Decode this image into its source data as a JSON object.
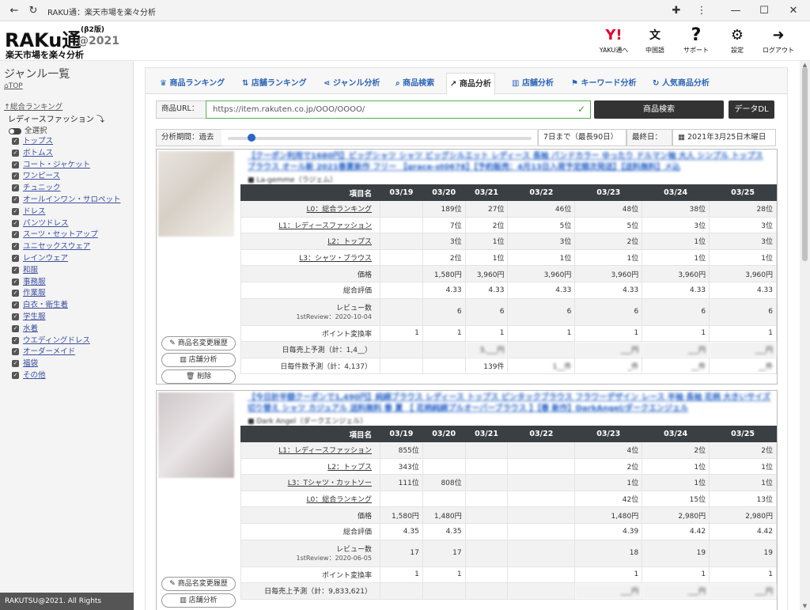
{
  "window": {
    "title": "RAKU通：楽天市場を楽々分析"
  },
  "header": {
    "logo_main": "RAKu通",
    "logo_beta": "(β2版)",
    "logo_year": "@2021",
    "logo_sub": "楽天市場を楽々分析",
    "nav": [
      {
        "icon": "Y!",
        "label": "YAKU通へ"
      },
      {
        "icon": "文",
        "label": "中国語"
      },
      {
        "icon": "?",
        "label": "サポート"
      },
      {
        "icon": "⚙",
        "label": "設定"
      },
      {
        "icon": "➜",
        "label": "ログアウト"
      }
    ]
  },
  "sidebar": {
    "title": "ジャンル一覧",
    "top_link": "TOP",
    "ranking_link": "総合ランキング",
    "category": "レディースファッション",
    "select_all": "全選択",
    "genres": [
      "トップス",
      "ボトムス",
      "コート・ジャケット",
      "ワンピース",
      "チュニック",
      "オールインワン・サロペット",
      "ドレス",
      "パンツドレス",
      "スーツ・セットアップ",
      "ユニセックスウェア",
      "レインウェア",
      "和服",
      "事務服",
      "作業服",
      "白衣・衛生着",
      "学生服",
      "水着",
      "ウエディングドレス",
      "オーダーメイド",
      "福袋",
      "その他"
    ],
    "footer": "RAKUTSU@2021. All Rights Reserved."
  },
  "tabs": [
    "商品ランキング",
    "店舗ランキング",
    "ジャンル分析",
    "商品検索",
    "商品分析",
    "店舗分析",
    "キーワード分析",
    "人気商品分析"
  ],
  "active_tab": "商品分析",
  "search": {
    "url_label": "商品URL：",
    "url_value": "https://item.rakuten.co.jp/OOO/OOOO/",
    "search_button": "商品検索",
    "download_button": "データDL"
  },
  "period": {
    "label": "分析期間：過去",
    "range_text": "7日まで（最長90日）",
    "last_date_label": "最終日：",
    "last_date_value": "2021年3月25日木曜日",
    "slider_value_days": 7,
    "slider_max_days": 90
  },
  "products": [
    {
      "title": "【クーポン利用で1680円】ビッグシャツ シャツ ビッグシルエット レディース 長袖 バンドカラー ゆったり ドルマン袖 大人 シンプル トップス ブラウス オール新 2021春夏新作 フリー 【grace-st0678】【予約販売：4月13日入荷予定順次発送】【送料無料】メ込",
      "shop": "La-gemme（ラジェム）",
      "headers": [
        "項目名",
        "03/19",
        "03/20",
        "03/21",
        "03/22",
        "03/23",
        "03/24",
        "03/25"
      ],
      "rows": [
        {
          "label": "L0：総合ランキング",
          "link": true,
          "values": [
            "",
            "189位",
            "27位",
            "46位",
            "48位",
            "38位",
            "28位"
          ]
        },
        {
          "label": "L1：レディースファッション",
          "link": true,
          "values": [
            "",
            "7位",
            "2位",
            "5位",
            "5位",
            "3位",
            "3位"
          ]
        },
        {
          "label": "L2：トップス",
          "link": true,
          "values": [
            "",
            "3位",
            "1位",
            "3位",
            "2位",
            "1位",
            "3位"
          ]
        },
        {
          "label": "L3：シャツ・ブラウス",
          "link": true,
          "values": [
            "",
            "2位",
            "1位",
            "1位",
            "1位",
            "1位",
            "1位"
          ]
        },
        {
          "label": "価格",
          "link": false,
          "values": [
            "",
            "1,580円",
            "3,960円",
            "3,960円",
            "3,960円",
            "3,960円",
            "3,960円"
          ]
        },
        {
          "label": "総合評価",
          "link": false,
          "values": [
            "",
            "4.33",
            "4.33",
            "4.33",
            "4.33",
            "4.33",
            "4.33"
          ]
        },
        {
          "label": "レビュー数",
          "sub": "1stReview：2020-10-04",
          "link": false,
          "values": [
            "",
            "6",
            "6",
            "6",
            "6",
            "6",
            "6"
          ]
        },
        {
          "label": "ポイント変換率",
          "link": false,
          "values": [
            "1",
            "1",
            "1",
            "1",
            "1",
            "1",
            "1"
          ]
        },
        {
          "label": "日毎売上予測（計：1,4__）",
          "link": false,
          "values": [
            "",
            "",
            "3,___円",
            "",
            "___円",
            "___円",
            "___円"
          ]
        },
        {
          "label": "日毎件数予測（計：4,137）",
          "link": false,
          "values": [
            "",
            "",
            "139件",
            "1__件",
            "_件",
            "__件",
            "__件"
          ]
        }
      ],
      "buttons": [
        "商品名変更履歴",
        "店舗分析",
        "削除"
      ]
    },
    {
      "title": "【今日計半額クーポンで1,490円】純綿ブラウス レディース トップス ピンタックブラウス フラワーデザイン レース 半袖 長袖 花柄 大きいサイズ 切り替え シャツ カジュアル 送料無料 春 夏 【 花柄純綿プルオーバーブラウス 】【春 新作】DarkAngel/ダークエンジェル",
      "shop": "Dark Angel（ダークエンジェル）",
      "headers": [
        "項目名",
        "03/19",
        "03/20",
        "03/21",
        "03/22",
        "03/23",
        "03/24",
        "03/25"
      ],
      "rows": [
        {
          "label": "L1：レディースファッション",
          "link": true,
          "values": [
            "855位",
            "",
            "",
            "",
            "4位",
            "2位",
            "2位"
          ]
        },
        {
          "label": "L2：トップス",
          "link": true,
          "values": [
            "343位",
            "",
            "",
            "",
            "2位",
            "1位",
            "1位"
          ]
        },
        {
          "label": "L3：Tシャツ・カットソー",
          "link": true,
          "values": [
            "111位",
            "808位",
            "",
            "",
            "1位",
            "1位",
            "1位"
          ]
        },
        {
          "label": "L0：総合ランキング",
          "link": true,
          "values": [
            "",
            "",
            "",
            "",
            "42位",
            "15位",
            "13位"
          ]
        },
        {
          "label": "価格",
          "link": false,
          "values": [
            "1,580円",
            "1,480円",
            "",
            "",
            "1,480円",
            "2,980円",
            "2,980円"
          ]
        },
        {
          "label": "総合評価",
          "link": false,
          "values": [
            "4.35",
            "4.35",
            "",
            "",
            "4.39",
            "4.42",
            "4.42"
          ]
        },
        {
          "label": "レビュー数",
          "sub": "1stReview：2020-06-05",
          "link": false,
          "values": [
            "17",
            "17",
            "",
            "",
            "18",
            "19",
            "19"
          ]
        },
        {
          "label": "ポイント変換率",
          "link": false,
          "values": [
            "1",
            "1",
            "",
            "",
            "1",
            "1",
            "1"
          ]
        },
        {
          "label": "日毎売上予測（計：9,833,621）",
          "link": false,
          "values": [
            "",
            "",
            "",
            "",
            "___円",
            "___円",
            "___円"
          ]
        }
      ],
      "buttons": [
        "商品名変更履歴",
        "店舗分析"
      ]
    }
  ]
}
